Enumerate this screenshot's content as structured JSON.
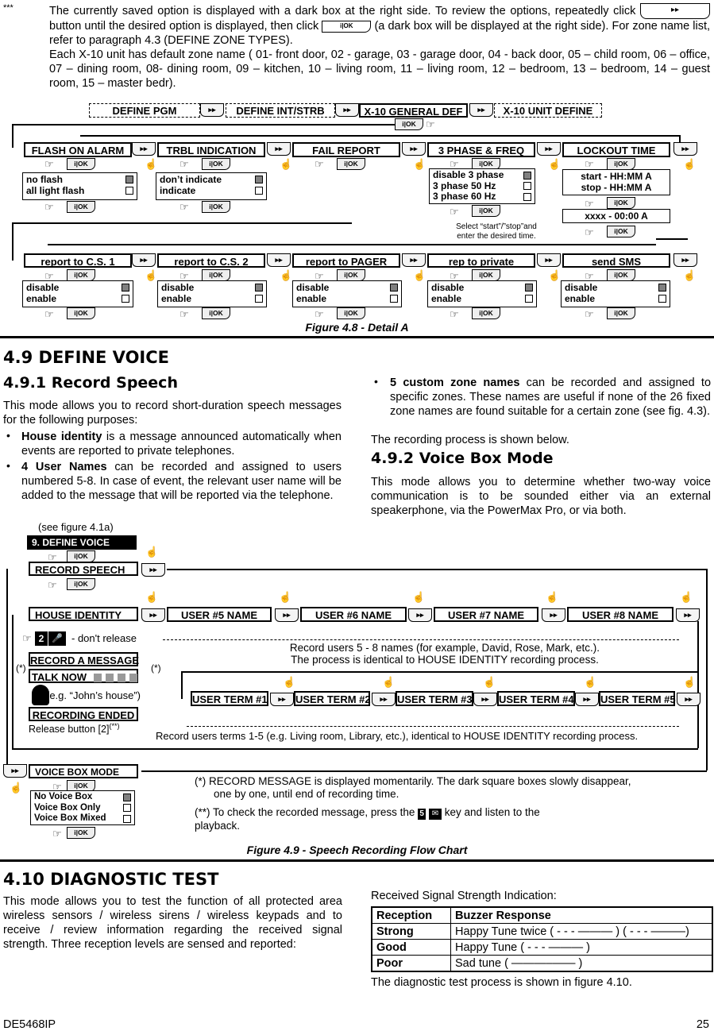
{
  "intro": {
    "stars": "***",
    "para1_a": "The currently saved option is displayed with a dark box at the right side. To review the options, repeatedly click",
    "para1_b": "button until the desired option is displayed, then click",
    "para1_c": "(a dark box will be displayed at the right side). For zone name list, refer to paragraph 4.3 (DEFINE ZONE TYPES).",
    "para2": "Each X-10 unit has default zone name ( 01- front door, 02 - garage, 03 - garage door, 04 - back door, 05 – child room, 06 – office, 07 – dining room, 08- dining room, 09 – kitchen, 10 – living room, 11 – living room, 12 – bedroom, 13 – bedroom, 14 – guest room, 15 – master bedr)."
  },
  "keys": {
    "next": "▸▸",
    "ok": "i|OK"
  },
  "fig48": {
    "top_menu": [
      "DEFINE PGM",
      "DEFINE INT/STRB",
      "X-10 GENERAL DEF",
      "X-10 UNIT DEFINE"
    ],
    "row1": [
      {
        "label": "FLASH ON ALARM",
        "options": [
          {
            "text": "no flash",
            "selected": true
          },
          {
            "text": "all light  flash",
            "selected": false
          }
        ]
      },
      {
        "label": "TRBL INDICATION",
        "options": [
          {
            "text": "don’t indicate",
            "selected": true
          },
          {
            "text": "indicate",
            "selected": false
          }
        ]
      },
      {
        "label": "FAIL REPORT"
      },
      {
        "label": "3 PHASE & FREQ",
        "options": [
          {
            "text": "disable 3 phase",
            "selected": true
          },
          {
            "text": "3 phase 50 Hz",
            "selected": false
          },
          {
            "text": "3 phase 60 Hz",
            "selected": false
          }
        ]
      },
      {
        "label": "LOCKOUT TIME",
        "lines": [
          "start - HH:MM A",
          "stop - HH:MM A"
        ],
        "entry": "xxxx -   00:00 A"
      }
    ],
    "lockout_note": [
      "Select “start”/”stop”and",
      "enter the desired time."
    ],
    "row2": [
      {
        "label": "report to C.S. 1",
        "options": [
          {
            "text": "disable",
            "selected": true
          },
          {
            "text": "enable",
            "selected": false
          }
        ]
      },
      {
        "label": "report to C.S. 2",
        "options": [
          {
            "text": "disable",
            "selected": true
          },
          {
            "text": "enable",
            "selected": false
          }
        ]
      },
      {
        "label": "report to PAGER",
        "options": [
          {
            "text": "disable",
            "selected": true
          },
          {
            "text": "enable",
            "selected": false
          }
        ]
      },
      {
        "label": "rep to private",
        "options": [
          {
            "text": "disable",
            "selected": true
          },
          {
            "text": "enable",
            "selected": false
          }
        ]
      },
      {
        "label": "send SMS",
        "options": [
          {
            "text": "disable",
            "selected": true
          },
          {
            "text": "enable",
            "selected": false
          }
        ]
      }
    ],
    "caption": "Figure 4.8 - Detail A"
  },
  "s49": {
    "title": "4.9 DEFINE VOICE",
    "sub1": "4.9.1 Record Speech",
    "p1": "This mode allows you to record short-duration speech messages for the following purposes:",
    "b1_bold": "House identity",
    "b1": " is a message announced automatically when events are reported to private telephones.",
    "b2_bold": "4 User Names",
    "b2": " can be recorded and assigned to users numbered 5-8. In case of event, the relevant user name will be added to the message that will be reported via the telephone.",
    "b3_bold": "5 custom zone names",
    "b3": " can be recorded and assigned to specific zones. These names are useful if none of the 26 fixed zone names are found suitable for a certain zone (see fig. 4.3).",
    "p2": "The recording process is shown below.",
    "sub2": "4.9.2 Voice Box Mode",
    "p3": "This mode allows you to determine whether two-way voice communication is to be sounded either via an external speakerphone, via the PowerMax Pro, or via both."
  },
  "fig49": {
    "see": "(see figure 4.1a)",
    "menu": "9. DEFINE VOICE",
    "record_speech": "RECORD SPEECH",
    "house_identity": "HOUSE IDENTITY",
    "users": [
      "USER #5 NAME",
      "USER #6 NAME",
      "USER #7 NAME",
      "USER #8 NAME"
    ],
    "users_note": [
      "Record users 5 - 8 names (for example, David, Rose, Mark, etc.).",
      "The process is identical to HOUSE IDENTITY recording process."
    ],
    "key2": "2",
    "dont_release": "- don't release",
    "record_msg": "RECORD A MESSAGE",
    "talk_now": "TALK NOW",
    "star": "(*)",
    "example": "(e.g. “John’s house”)",
    "rec_ended": "RECORDING ENDED",
    "release": "Release button  [2]",
    "dstar": "(**)",
    "terms": [
      "USER TERM #1",
      "USER TERM #2",
      "USER TERM #3",
      "USER TERM #4",
      "USER TERM #5"
    ],
    "terms_note": "Record users terms 1-5 (e.g. Living room, Library, etc.), identical to HOUSE IDENTITY recording process.",
    "voice_box": "VOICE BOX MODE",
    "voice_options": [
      {
        "text": "No Voice Box",
        "selected": true
      },
      {
        "text": "Voice Box Only",
        "selected": false
      },
      {
        "text": "Voice Box Mixed",
        "selected": false
      }
    ],
    "note1_a": "(*)  RECORD MESSAGE is displayed momentarily. The dark square boxes slowly disappear,",
    "note1_b": "one by one, until end of recording time.",
    "note2_a": "(**) To check the recorded message, press the",
    "key5": "5",
    "note2_b": "key and listen to the",
    "note2_c": "playback.",
    "caption": "Figure 4.9 - Speech Recording Flow Chart"
  },
  "s410": {
    "title": "4.10 DIAGNOSTIC TEST",
    "p1": "This mode allows you to test the function of all protected area wireless sensors / wireless sirens / wireless keypads and to receive / review information regarding the received signal strength. Three reception levels are sensed and reported:",
    "rssi": "Received Signal Strength Indication:",
    "table": {
      "headers": [
        "Reception",
        "Buzzer Response"
      ],
      "rows": [
        [
          "Strong",
          "Happy Tune twice ( - - - ——— ) ( - - - ———)"
        ],
        [
          "Good",
          "Happy Tune ( - - - ——— )"
        ],
        [
          "Poor",
          "Sad tune ( ———–—— )"
        ]
      ]
    },
    "p2": "The diagnostic test process is shown in figure 4.10."
  },
  "footer": {
    "doc": "DE5468IP",
    "page": "25"
  }
}
